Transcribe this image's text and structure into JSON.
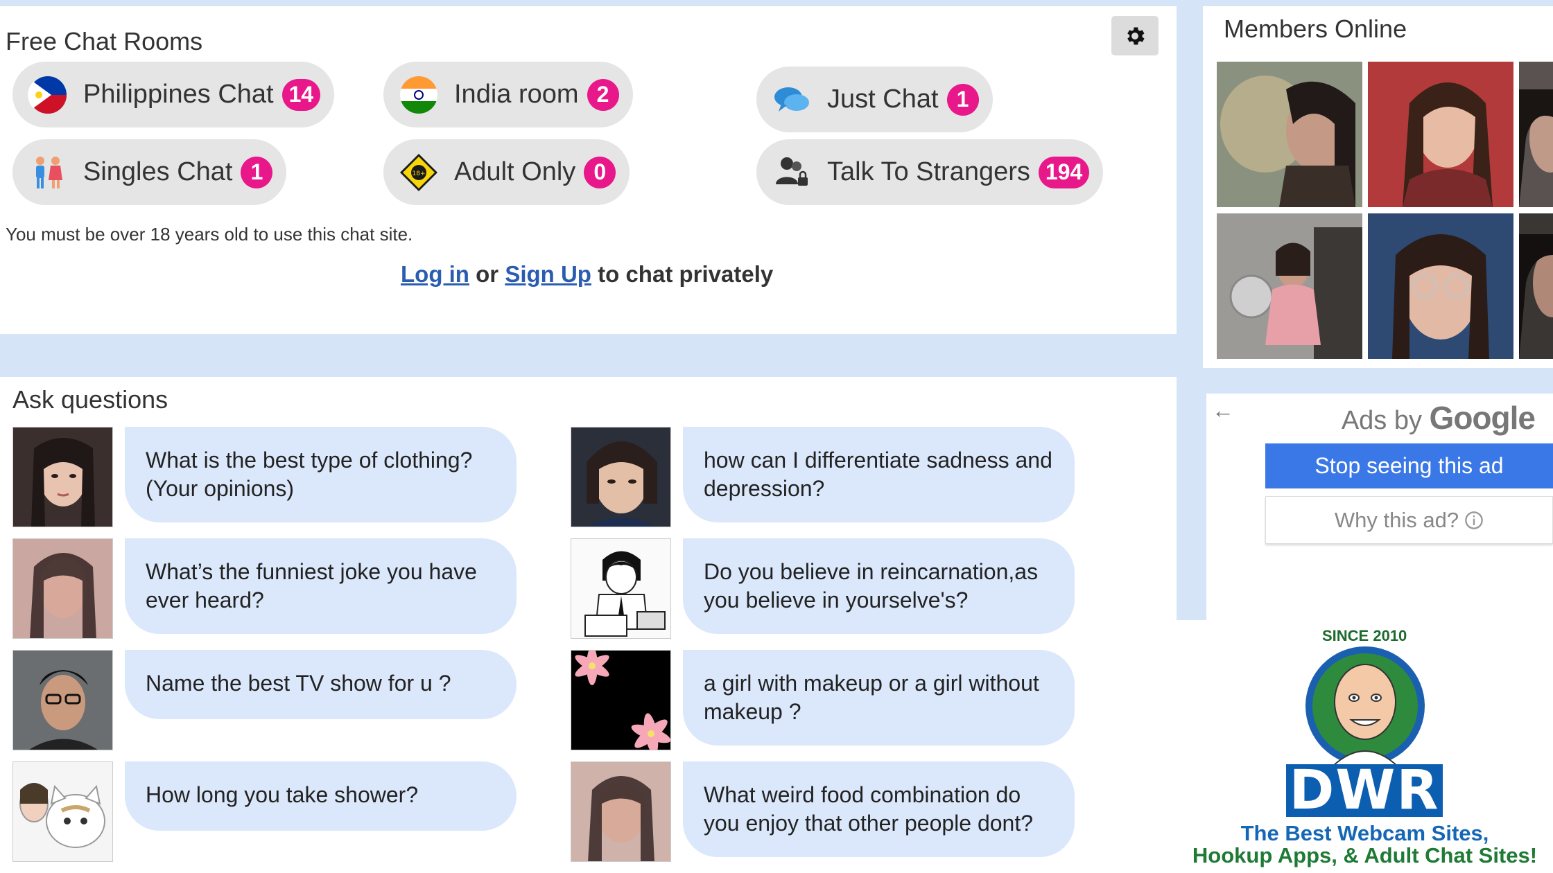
{
  "rooms": {
    "title": "Free Chat Rooms",
    "items": [
      {
        "name": "Philippines Chat",
        "count": "14",
        "icon": "philippines-flag-icon"
      },
      {
        "name": "India room",
        "count": "2",
        "icon": "india-flag-icon"
      },
      {
        "name": "Just Chat",
        "count": "1",
        "icon": "speech-bubbles-icon"
      },
      {
        "name": "Singles Chat",
        "count": "1",
        "icon": "couple-icon"
      },
      {
        "name": "Adult Only",
        "count": "0",
        "icon": "adult-warning-icon"
      },
      {
        "name": "Talk To Strangers",
        "count": "194",
        "icon": "people-lock-icon"
      }
    ],
    "age_notice": "You must be over 18 years old to use this chat site.",
    "login_label": "Log in",
    "or_text": "or",
    "signup_label": "Sign Up",
    "privately_text": "to chat privately"
  },
  "questions": {
    "title": "Ask questions",
    "items": [
      {
        "text": "What is the best type of clothing? (Your opinions)"
      },
      {
        "text": "how can I differentiate sadness and depression?"
      },
      {
        "text": "What’s the funniest joke you have ever heard?"
      },
      {
        "text": "Do you believe in reincarnation,as you believe in yourselve's?"
      },
      {
        "text": "Name the best TV show for u ?"
      },
      {
        "text": "a girl with makeup or a girl without makeup ?"
      },
      {
        "text": "How long you take shower?"
      },
      {
        "text": "What weird food combination do you enjoy that other people dont?"
      }
    ]
  },
  "members": {
    "title": "Members Online"
  },
  "ads": {
    "back_icon": "arrow-left-icon",
    "ads_by_text": "Ads by",
    "google_text": "Google",
    "stop_label": "Stop seeing this ad",
    "why_label": "Why this ad?",
    "info_icon": "info-icon"
  },
  "banner": {
    "since_text": "SINCE 2010",
    "logo_text": "DWR",
    "tagline_1": "The Best Webcam Sites,",
    "tagline_2": "Hookup Apps, & Adult Chat Sites!"
  },
  "colors": {
    "page_bg": "#d6e4f7",
    "badge": "#e8178a",
    "link": "#2a5db0",
    "bubble": "#dbe8fb",
    "google_button": "#3b78e7"
  }
}
